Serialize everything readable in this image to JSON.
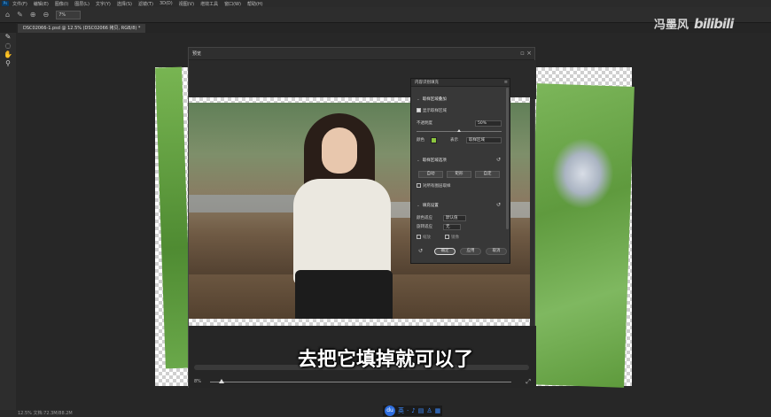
{
  "menubar": {
    "logo": "Ps",
    "items": [
      "文件(F)",
      "编辑(E)",
      "图像(I)",
      "图层(L)",
      "文字(Y)",
      "选择(S)",
      "滤镜(T)",
      "3D(D)",
      "视图(V)",
      "增效工具",
      "窗口(W)",
      "帮助(H)"
    ]
  },
  "optbar": {
    "home_icon": "home-icon",
    "zoom_value": "7%"
  },
  "document_tab": {
    "label": "DSC02066-1.psd @ 12.5% (DSC02066 拷贝, RGB/8) *"
  },
  "dialog": {
    "title": "预览",
    "zoom_label": "8%"
  },
  "panel": {
    "title": "内容识别填充",
    "sampling_overlay_section": "取样区域叠加",
    "show_sampling_area_label": "显示取样区域",
    "opacity_label": "不透明度",
    "opacity_value": "50%",
    "opacity_fraction": 0.5,
    "color_label": "颜色",
    "indicates_label": "表示",
    "indicates_value": "取样区域",
    "sampling_options_section": "取样区域选项",
    "auto_label": "自动",
    "rect_label": "矩形",
    "custom_label": "自定",
    "sample_all_layers_label": "对所有图层取样",
    "fill_settings_section": "填充设置",
    "color_adapt_label": "颜色适应",
    "color_adapt_value": "默认值",
    "rotation_adapt_label": "旋转适应",
    "rotation_adapt_value": "无",
    "scale_label": "缩放",
    "mirror_label": "镜像",
    "ok_label": "确定",
    "apply_label": "应用",
    "cancel_label": "取消",
    "swatch_color": "#8cc63f"
  },
  "subtitle": "去把它填掉就可以了",
  "watermark": {
    "author": "冯墨风",
    "brand": "bilibili"
  },
  "statusbar": {
    "text": "12.5%    文档:72.3M/88.2M"
  },
  "taskdock": {
    "logo": "du",
    "icons": [
      "英",
      "·",
      "♪",
      "▤",
      "♙",
      "▦"
    ]
  }
}
